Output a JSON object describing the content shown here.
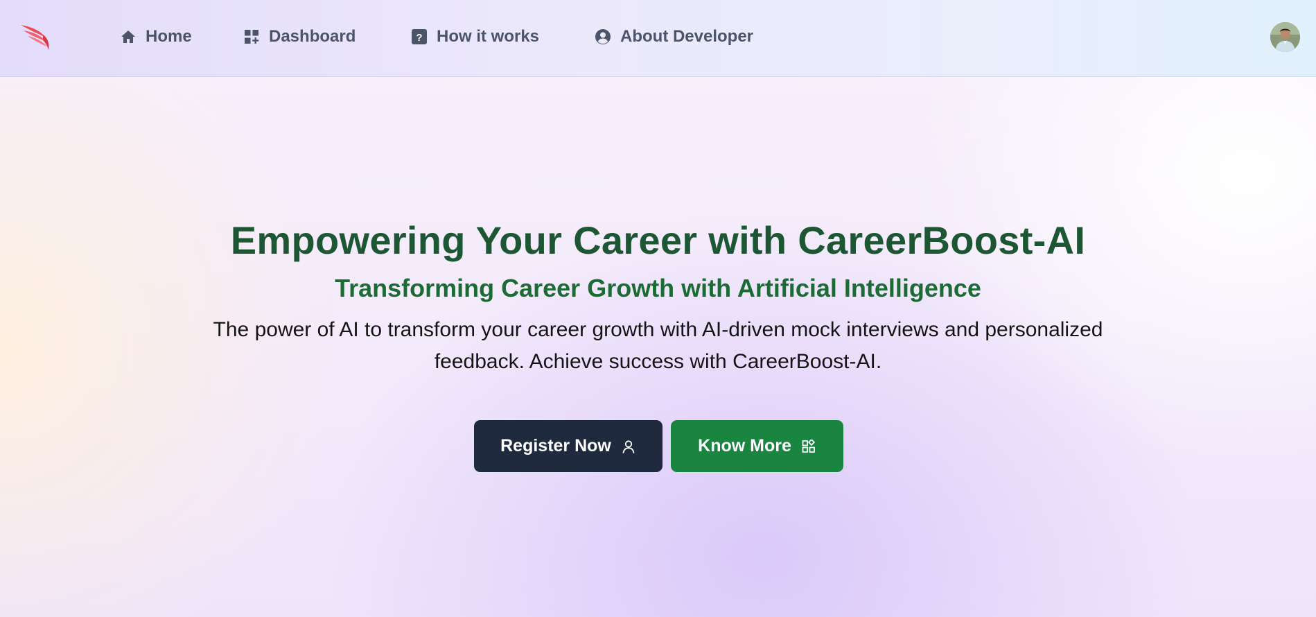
{
  "nav": {
    "logo_icon": "wing-logo-icon",
    "items": [
      {
        "label": "Home",
        "icon": "home-icon"
      },
      {
        "label": "Dashboard",
        "icon": "dashboard-grid-icon"
      },
      {
        "label": "How it works",
        "icon": "question-square-icon"
      },
      {
        "label": "About Developer",
        "icon": "user-circle-icon"
      }
    ],
    "avatar_icon": "profile-avatar"
  },
  "hero": {
    "title": "Empowering Your Career with CareerBoost-AI",
    "subtitle": "Transforming Career Growth with Artificial Intelligence",
    "description": "The power of AI to transform your career growth with AI-driven mock interviews and personalized feedback. Achieve success with CareerBoost-AI.",
    "buttons": {
      "register": {
        "label": "Register Now",
        "icon": "user-outline-icon"
      },
      "know_more": {
        "label": "Know More",
        "icon": "widgets-icon"
      }
    }
  },
  "colors": {
    "title_green": "#1d5632",
    "subtitle_green": "#1c6a34",
    "register_bg": "#1f2a3e",
    "know_more_bg": "#1a8441",
    "nav_text": "#4b5468",
    "logo_red": "#ef4b57"
  }
}
